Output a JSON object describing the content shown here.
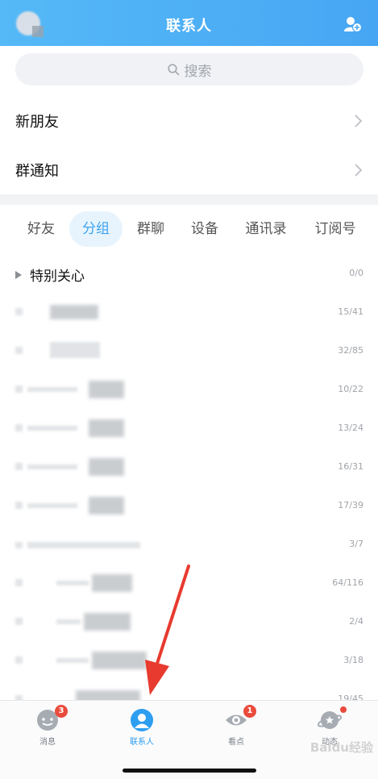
{
  "header": {
    "title": "联系人"
  },
  "search": {
    "placeholder": "搜索"
  },
  "rows": [
    {
      "label": "新朋友"
    },
    {
      "label": "群通知"
    }
  ],
  "tabs": [
    {
      "label": "好友",
      "active": false
    },
    {
      "label": "分组",
      "active": true
    },
    {
      "label": "群聊",
      "active": false
    },
    {
      "label": "设备",
      "active": false
    },
    {
      "label": "通讯录",
      "active": false
    },
    {
      "label": "订阅号",
      "active": false
    }
  ],
  "groups": [
    {
      "label": "特别关心",
      "count": "0/0"
    },
    {
      "label": "",
      "count": "15/41"
    },
    {
      "label": "",
      "count": "32/85"
    },
    {
      "label": "",
      "count": "10/22"
    },
    {
      "label": "",
      "count": "13/24"
    },
    {
      "label": "",
      "count": "16/31"
    },
    {
      "label": "",
      "count": "17/39"
    },
    {
      "label": "",
      "count": "3/7"
    },
    {
      "label": "",
      "count": "64/116"
    },
    {
      "label": "",
      "count": "2/4"
    },
    {
      "label": "",
      "count": "3/18"
    },
    {
      "label": "",
      "count": "19/45"
    }
  ],
  "tabbar": [
    {
      "label": "消息",
      "icon": "message-icon",
      "badge": "3"
    },
    {
      "label": "联系人",
      "icon": "contacts-icon",
      "badge": ""
    },
    {
      "label": "看点",
      "icon": "eye-icon",
      "badge": "1"
    },
    {
      "label": "动态",
      "icon": "planet-icon",
      "badge": ""
    }
  ],
  "watermark": "Baidu经验",
  "colors": {
    "accent": "#3ea3f2",
    "header": "#4fb1f5",
    "badge": "#e94b3c"
  }
}
